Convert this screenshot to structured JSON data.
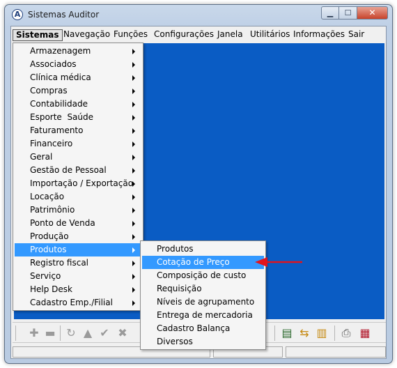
{
  "window": {
    "title": "Sistemas Auditor",
    "app_icon": "A"
  },
  "menubar": [
    "Sistemas",
    "Navegação",
    "Funções",
    "Configurações",
    "Janela",
    "Utilitários",
    "Informações",
    "Sair"
  ],
  "sistemas_menu": [
    "Armazenagem",
    "Associados",
    "Clínica médica",
    "Compras",
    "Contabilidade",
    "Esporte  Saúde",
    "Faturamento",
    "Financeiro",
    "Geral",
    "Gestão de Pessoal",
    "Importação / Exportação",
    "Locação",
    "Patrimônio",
    "Ponto de Venda",
    "Produção",
    "Produtos",
    "Registro fiscal",
    "Serviço",
    "Help Desk",
    "Cadastro Emp./Filial"
  ],
  "produtos_submenu": [
    "Produtos",
    "Cotação de Preço",
    "Composição de custo",
    "Requisição",
    "Níveis de agrupamento",
    "Entrega de mercadoria",
    "Cadastro Balança",
    "Diversos"
  ],
  "colors": {
    "mdi_background": "#0a5cc4",
    "highlight": "#3399ff",
    "pointer": "#e0141e"
  }
}
